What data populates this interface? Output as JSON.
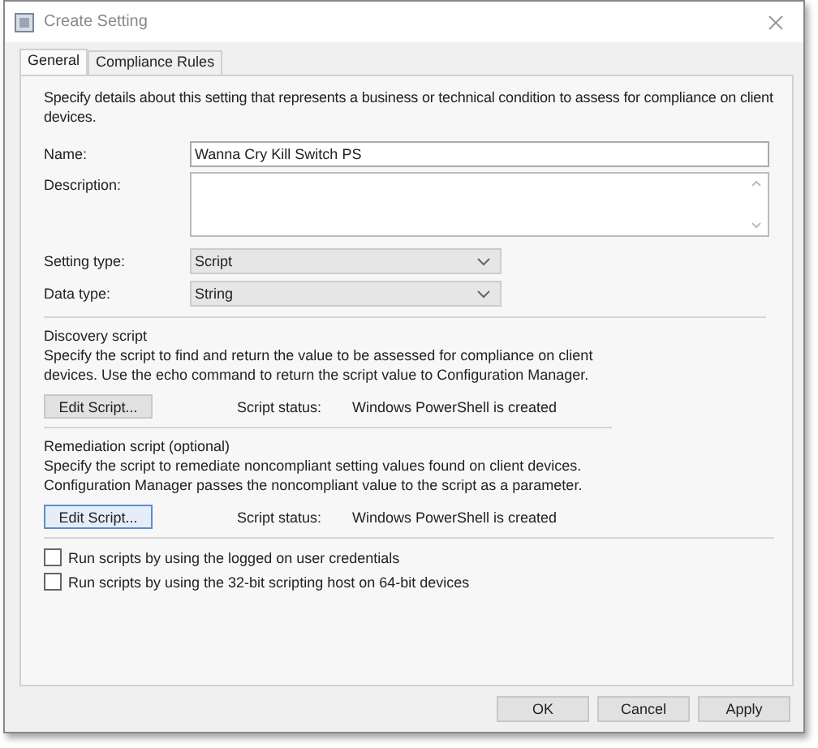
{
  "window": {
    "title": "Create Setting"
  },
  "tabs": [
    {
      "label": "General",
      "selected": true
    },
    {
      "label": "Compliance Rules",
      "selected": false
    }
  ],
  "intro": "Specify details about this setting that represents a business or technical condition to assess for compliance on client devices.",
  "name_field": {
    "label": "Name:",
    "value": "Wanna Cry Kill Switch PS"
  },
  "description_field": {
    "label": "Description:"
  },
  "dropdowns": [
    {
      "label": "Setting type:",
      "value": "Script"
    },
    {
      "label": "Data type:",
      "value": "String"
    }
  ],
  "scripts": [
    {
      "title": "Discovery script",
      "text": "Specify the script to find and return the value to be assessed for compliance on client devices. Use the echo command to return the script value to Configuration Manager.",
      "button": "Edit Script...",
      "focused": false,
      "status_label": "Script status:",
      "status_value": "Windows PowerShell is created"
    },
    {
      "title": "Remediation script (optional)",
      "text": "Specify the script to remediate noncompliant setting values found on client devices. Configuration Manager passes the noncompliant value to the script as a parameter.",
      "button": "Edit Script...",
      "focused": true,
      "status_label": "Script status:",
      "status_value": "Windows PowerShell is created"
    }
  ],
  "checkboxes": [
    {
      "label": "Run scripts by using the logged on user credentials",
      "checked": false
    },
    {
      "label": "Run scripts by using the 32-bit scripting host on 64-bit devices",
      "checked": false
    }
  ],
  "buttons": [
    "OK",
    "Cancel",
    "Apply"
  ]
}
